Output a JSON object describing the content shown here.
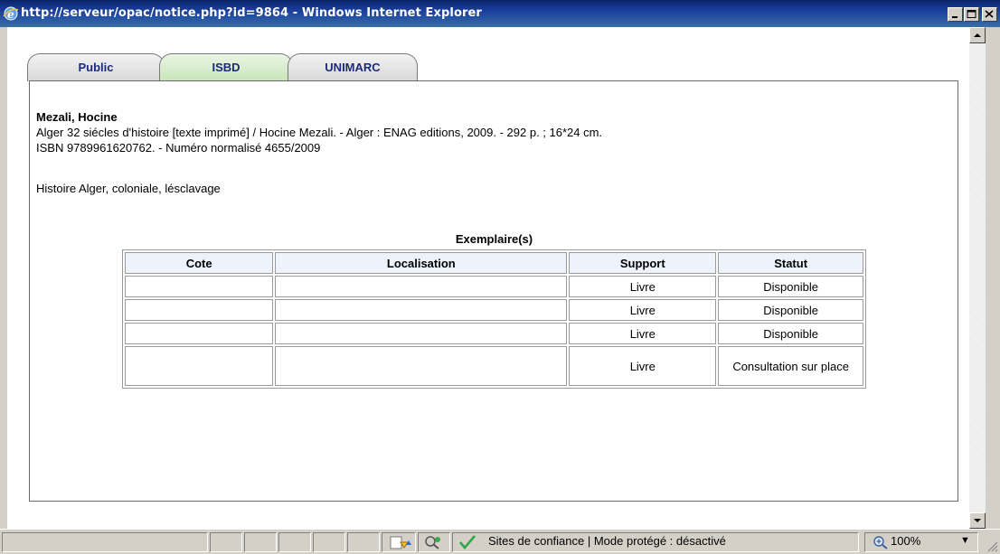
{
  "window": {
    "title": "http://serveur/opac/notice.php?id=9864 - Windows Internet Explorer"
  },
  "tabs": [
    {
      "label": "Public"
    },
    {
      "label": "ISBD"
    },
    {
      "label": "UNIMARC"
    }
  ],
  "record": {
    "author": "Mezali, Hocine",
    "description": "Alger 32 siécles d'histoire [texte imprimé] / Hocine Mezali. - Alger : ENAG editions, 2009. - 292 p. ; 16*24 cm.",
    "isbn_line": "ISBN 9789961620762. - Numéro normalisé 4655/2009",
    "subjects": "Histoire Alger, coloniale, lésclavage"
  },
  "copies": {
    "caption": "Exemplaire(s)",
    "columns": [
      "Cote",
      "Localisation",
      "Support",
      "Statut"
    ],
    "rows": [
      {
        "cote": "",
        "localisation": "",
        "support": "Livre",
        "statut": "Disponible"
      },
      {
        "cote": "",
        "localisation": "",
        "support": "Livre",
        "statut": "Disponible"
      },
      {
        "cote": "",
        "localisation": "",
        "support": "Livre",
        "statut": "Disponible"
      },
      {
        "cote": "",
        "localisation": "",
        "support": "Livre",
        "statut": "Consultation sur place"
      }
    ]
  },
  "statusbar": {
    "zone_text": "Sites de confiance | Mode protégé : désactivé",
    "zoom": "100%",
    "icons": [
      "page-warning-icon",
      "security-report-icon",
      "trusted-site-check-icon",
      "zoom-icon"
    ]
  },
  "colors": {
    "titlebar": "#0a246a",
    "tab_text": "#1d2a7a",
    "tab_isbd": "#c9e4bb",
    "table_header": "#eef2fa"
  }
}
